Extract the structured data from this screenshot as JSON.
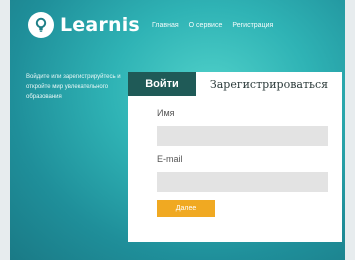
{
  "brand": {
    "name": "Learnis",
    "icon": "lightbulb-icon",
    "accent": "#2fb3b5"
  },
  "nav": {
    "items": [
      "Главная",
      "О сервисе",
      "Регистрация"
    ]
  },
  "intro": {
    "text": "Войдите или зарегистрируйтесь и откройте мир увлекательного образования"
  },
  "tabs": {
    "login": "Войти",
    "register": "Зарегистрироваться"
  },
  "form": {
    "name_label": "Имя",
    "name_value": "",
    "email_label": "E-mail",
    "email_value": "",
    "submit_label": "Далее",
    "submit_color": "#f0a922"
  }
}
